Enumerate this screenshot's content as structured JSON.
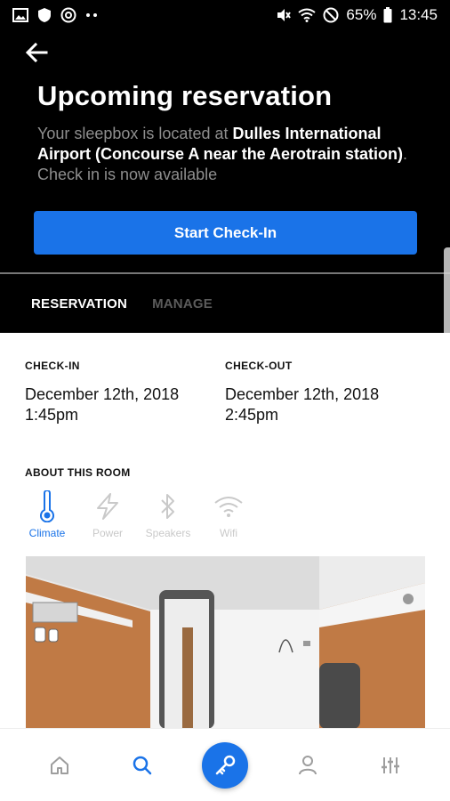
{
  "status_bar": {
    "battery_percent": "65%",
    "time": "13:45",
    "left_icons": [
      "image-icon",
      "shield-icon",
      "at-icon",
      "dots-icon"
    ],
    "right_icons": [
      "mute-icon",
      "wifi-icon",
      "dnd-icon",
      "battery-icon"
    ]
  },
  "header": {
    "title": "Upcoming reservation",
    "desc_prefix": "Your sleepbox is located at ",
    "desc_location": "Dulles International Airport (Concourse A near the Aerotrain station)",
    "desc_suffix": ". Check in is now available",
    "checkin_button": "Start Check-In"
  },
  "tabs": [
    {
      "label": "RESERVATION",
      "active": true
    },
    {
      "label": "MANAGE",
      "active": false
    }
  ],
  "reservation": {
    "checkin_label": "CHECK-IN",
    "checkin_date": "December 12th, 2018",
    "checkin_time": "1:45pm",
    "checkout_label": "CHECK-OUT",
    "checkout_date": "December 12th, 2018",
    "checkout_time": "2:45pm"
  },
  "about": {
    "title": "ABOUT THIS ROOM",
    "amenities": [
      {
        "label": "Climate",
        "icon": "thermometer-icon",
        "active": true
      },
      {
        "label": "Power",
        "icon": "lightning-icon",
        "active": false
      },
      {
        "label": "Speakers",
        "icon": "bluetooth-icon",
        "active": false
      },
      {
        "label": "Wifi",
        "icon": "wifi-icon",
        "active": false
      }
    ]
  },
  "bottom_nav": [
    {
      "icon": "home-icon",
      "active": false
    },
    {
      "icon": "search-icon",
      "active": true
    },
    {
      "icon": "key-icon",
      "active": true
    },
    {
      "icon": "person-icon",
      "active": false
    },
    {
      "icon": "sliders-icon",
      "active": false
    }
  ],
  "colors": {
    "accent": "#1a73e8",
    "header_bg": "#000000",
    "muted_text": "#8e8e8e"
  }
}
